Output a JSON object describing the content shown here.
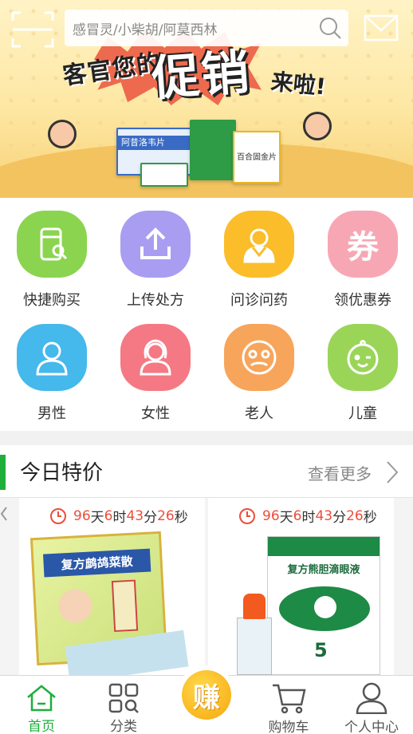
{
  "search": {
    "placeholder": "感冒灵/小柴胡/阿莫西林"
  },
  "banner": {
    "promo_a": "客官您的",
    "promo_b": "促销",
    "promo_c": "来啦!",
    "product_a": "阿昔洛韦片",
    "product_b": "百合固金片",
    "colors": {
      "background": "#fde7a3",
      "burst": "#ee6a4e"
    }
  },
  "quick_actions": [
    {
      "label": "快捷购买",
      "icon": "phone-search-icon",
      "color": "#8bd44f"
    },
    {
      "label": "上传处方",
      "icon": "upload-icon",
      "color": "#a99df2"
    },
    {
      "label": "问诊问药",
      "icon": "doctor-icon",
      "color": "#fbbd2a"
    },
    {
      "label": "领优惠券",
      "icon": "coupon-icon",
      "color": "#f7a7b4",
      "icon_text": "券"
    },
    {
      "label": "男性",
      "icon": "man-icon",
      "color": "#45b8ec"
    },
    {
      "label": "女性",
      "icon": "woman-icon",
      "color": "#f47984"
    },
    {
      "label": "老人",
      "icon": "elder-icon",
      "color": "#f7a55b"
    },
    {
      "label": "儿童",
      "icon": "child-icon",
      "color": "#9ad558"
    }
  ],
  "deals": {
    "title": "今日特价",
    "more": "查看更多",
    "accent": "#1fae3c",
    "items": [
      {
        "timer": {
          "d": "96",
          "du": "天",
          "h": "6",
          "hu": "时",
          "m": "43",
          "mu": "分",
          "s": "26",
          "su": "秒"
        },
        "product_name": "复方鹧鸪菜散"
      },
      {
        "timer": {
          "d": "96",
          "du": "天",
          "h": "6",
          "hu": "时",
          "m": "43",
          "mu": "分",
          "s": "26",
          "su": "秒"
        },
        "product_name": "复方熊胆滴眼液",
        "product_volume": "5"
      }
    ]
  },
  "tabbar": {
    "home": "首页",
    "category": "分类",
    "earn": "赚",
    "cart": "购物车",
    "profile": "个人中心",
    "active": "home"
  }
}
